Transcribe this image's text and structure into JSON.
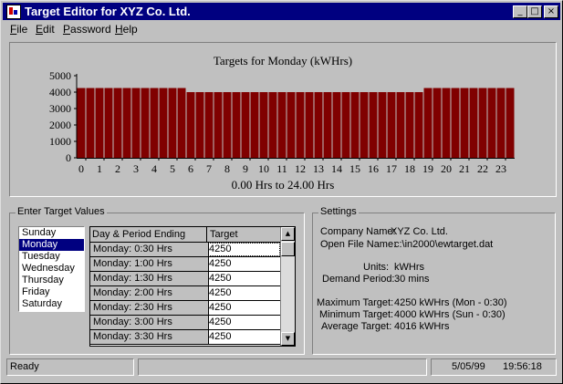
{
  "window": {
    "title": "Target Editor for XYZ Co. Ltd."
  },
  "caption_buttons": {
    "minimize": "_",
    "maximize": "□",
    "close": "×"
  },
  "menu": [
    {
      "label": "File",
      "key": "F",
      "rest": "ile"
    },
    {
      "label": "Edit",
      "key": "E",
      "rest": "dit"
    },
    {
      "label": "Password",
      "key": "P",
      "rest": "assword"
    },
    {
      "label": "Help",
      "key": "H",
      "rest": "elp"
    }
  ],
  "chart_data": {
    "type": "bar",
    "title": "Targets for Monday (kWHrs)",
    "xlabel": "0.00 Hrs to 24.00 Hrs",
    "ylabel": "",
    "ylim": [
      0,
      5000
    ],
    "y_ticks": [
      0,
      1000,
      2000,
      3000,
      4000,
      5000
    ],
    "x_tick_labels": [
      "0",
      "1",
      "2",
      "3",
      "4",
      "5",
      "6",
      "7",
      "8",
      "9",
      "10",
      "11",
      "12",
      "13",
      "14",
      "15",
      "16",
      "17",
      "18",
      "19",
      "20",
      "21",
      "22",
      "23"
    ],
    "bar_color": "#800000",
    "grid": false,
    "legend": "none",
    "values": [
      4250,
      4250,
      4250,
      4250,
      4250,
      4250,
      4250,
      4250,
      4250,
      4250,
      4250,
      4250,
      4000,
      4000,
      4000,
      4000,
      4000,
      4000,
      4000,
      4000,
      4000,
      4000,
      4000,
      4000,
      4000,
      4000,
      4000,
      4000,
      4000,
      4000,
      4000,
      4000,
      4000,
      4000,
      4000,
      4000,
      4000,
      4000,
      4250,
      4250,
      4250,
      4250,
      4250,
      4250,
      4250,
      4250,
      4250,
      4250
    ]
  },
  "target_group": {
    "title": "Enter Target Values"
  },
  "days": [
    "Sunday",
    "Monday",
    "Tuesday",
    "Wednesday",
    "Thursday",
    "Friday",
    "Saturday"
  ],
  "selected_day": "Monday",
  "grid": {
    "headers": [
      "Day & Period Ending",
      "Target"
    ],
    "rows": [
      {
        "period": "Monday: 0:30 Hrs",
        "target": "4250"
      },
      {
        "period": "Monday: 1:00 Hrs",
        "target": "4250"
      },
      {
        "period": "Monday: 1:30 Hrs",
        "target": "4250"
      },
      {
        "period": "Monday: 2:00 Hrs",
        "target": "4250"
      },
      {
        "period": "Monday: 2:30 Hrs",
        "target": "4250"
      },
      {
        "period": "Monday: 3:00 Hrs",
        "target": "4250"
      },
      {
        "period": "Monday: 3:30 Hrs",
        "target": "4250"
      }
    ]
  },
  "settings": {
    "title": "Settings",
    "company_label": "Company Name:",
    "company_value": "XYZ Co. Ltd.",
    "file_label": "Open File Name:",
    "file_value": "c:\\in2000\\ewtarget.dat",
    "units_label": "Units:",
    "units_value": "kWHrs",
    "demand_label": "Demand Period:",
    "demand_value": "30 mins",
    "max_label": "Maximum Target:",
    "max_value": "4250 kWHrs  (Mon - 0:30)",
    "min_label": "Minimum Target:",
    "min_value": "4000 kWHrs  (Sun - 0:30)",
    "avg_label": "Average Target:",
    "avg_value": "4016 kWHrs"
  },
  "status": {
    "text": "Ready",
    "middle": "",
    "date": "5/05/99",
    "time": "19:56:18"
  }
}
